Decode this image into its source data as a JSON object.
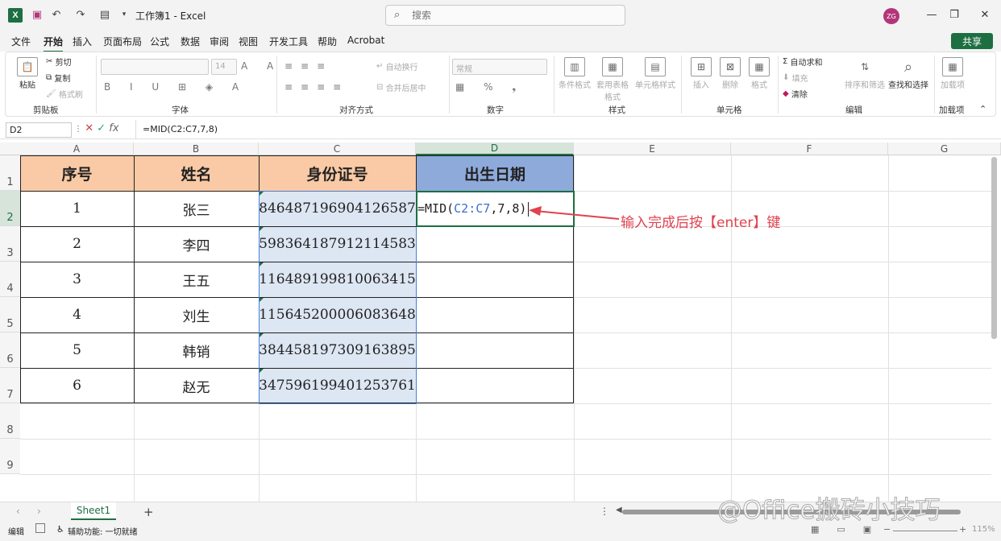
{
  "app": {
    "title": "工作簿1 - Excel",
    "search_placeholder": "搜索",
    "avatar": "ZG"
  },
  "menu": [
    "文件",
    "开始",
    "插入",
    "页面布局",
    "公式",
    "数据",
    "审阅",
    "视图",
    "开发工具",
    "帮助",
    "Acrobat"
  ],
  "share_label": "共享",
  "ribbon": {
    "clipboard": {
      "paste": "粘贴",
      "cut": "剪切",
      "copy": "复制",
      "format_painter": "格式刷",
      "label": "剪贴板"
    },
    "font": {
      "size": "14",
      "label": "字体"
    },
    "align": {
      "wrap": "自动换行",
      "merge": "合并后居中",
      "label": "对齐方式"
    },
    "number": {
      "format": "常规",
      "label": "数字"
    },
    "styles": {
      "cond": "条件格式",
      "table": "套用表格格式",
      "cell": "单元格样式",
      "label": "样式"
    },
    "cells": {
      "insert": "插入",
      "delete": "删除",
      "format": "格式",
      "label": "单元格"
    },
    "editing": {
      "autosum": "自动求和",
      "fill": "填充",
      "clear": "清除",
      "sort": "排序和筛选",
      "find": "查找和选择",
      "label": "编辑"
    },
    "addins": {
      "addin": "加载项",
      "label": "加载项"
    }
  },
  "formula_bar": {
    "name_box": "D2",
    "formula": "=MID(C2:C7,7,8)"
  },
  "columns": [
    "A",
    "B",
    "C",
    "D",
    "E",
    "F",
    "G"
  ],
  "rows": [
    "1",
    "2",
    "3",
    "4",
    "5",
    "6",
    "7",
    "8",
    "9"
  ],
  "table": {
    "headers": [
      "序号",
      "姓名",
      "身份证号",
      "出生日期"
    ],
    "rows": [
      [
        "1",
        "张三",
        "846487196904126587"
      ],
      [
        "2",
        "李四",
        "598364187912114583"
      ],
      [
        "3",
        "王五",
        "116489199810063415"
      ],
      [
        "4",
        "刘生",
        "115645200006083648"
      ],
      [
        "5",
        "韩销",
        "384458197309163895"
      ],
      [
        "6",
        "赵无",
        "347596199401253761"
      ]
    ],
    "editing_cell": {
      "prefix": "=MID(",
      "ref": "C2:C7",
      "suffix": ",7,8)"
    }
  },
  "annotation": "输入完成后按【enter】键",
  "sheet_tab": "Sheet1",
  "status": {
    "mode": "编辑",
    "accessibility": "辅助功能: 一切就绪",
    "zoom": "115%"
  },
  "watermark": "@Office搬砖小技巧",
  "colors": {
    "header_orange": "#f9caa5",
    "header_blue": "#8eaadb",
    "column_c": "#dde6f3",
    "accent_green": "#1d6f42",
    "annotation_red": "#e0424e"
  }
}
